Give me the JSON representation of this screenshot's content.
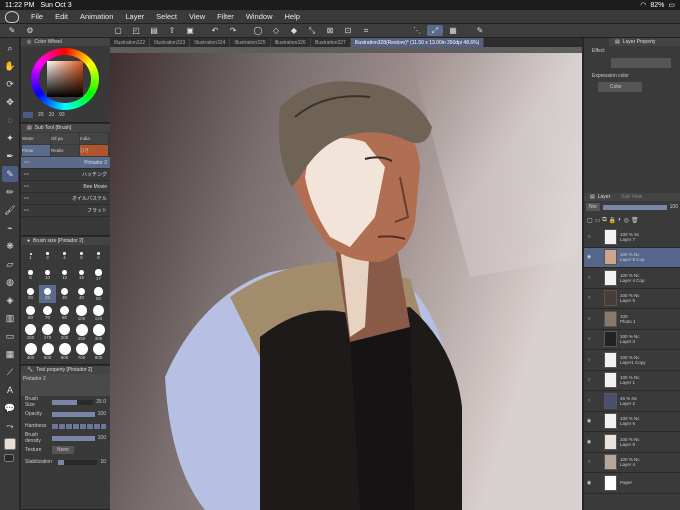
{
  "status": {
    "time": "11:22 PM",
    "date": "Sun Oct 3",
    "battery": "82%"
  },
  "menu": [
    "File",
    "Edit",
    "Animation",
    "Layer",
    "Select",
    "View",
    "Filter",
    "Window",
    "Help"
  ],
  "tabs": [
    "Illustration322",
    "Illustration323",
    "Illustration324",
    "Illustration325",
    "Illustration326",
    "Illustration327"
  ],
  "active_tab": "Illustration328(Restore)* (11.50 x 13.00in 350dpi 48.6%)",
  "color_wheel": {
    "title": "Color Wheel",
    "values": [
      "20",
      "10",
      "93"
    ]
  },
  "sub_tool": {
    "title": "Sub Tool [Brush]",
    "tabs": [
      "Water",
      "Oil pa",
      "India",
      "Pintar",
      "Realis",
      "ひき"
    ],
    "items": [
      "Pintador 2",
      "ハッチング",
      "Bee Movie",
      "オイルパステル",
      "フラット"
    ]
  },
  "brush_size": {
    "title": "Brush size [Pintador 2]",
    "sizes": [
      "1",
      "3",
      "4",
      "5",
      "6",
      "8",
      "10",
      "12",
      "15",
      "17",
      "20",
      "25",
      "30",
      "40",
      "50",
      "60",
      "70",
      "80",
      "100",
      "120",
      "150",
      "170",
      "200",
      "250",
      "300",
      "400",
      "500",
      "600",
      "700",
      "800"
    ]
  },
  "tool_property": {
    "title": "Tool property [Pintador 2]",
    "brush_name": "Pintador 2",
    "brush_size_label": "Brush Size",
    "brush_size_value": "25.0",
    "opacity_label": "Opacity",
    "opacity_value": "100",
    "hardness_label": "Hardness",
    "density_label": "Brush density",
    "density_value": "100",
    "texture_label": "Texture",
    "texture_value": "None",
    "stabilization_label": "Stabilization",
    "stabilization_value": "10"
  },
  "layer_property": {
    "title": "Layer Property",
    "effect_label": "Effect",
    "expression_label": "Expression color",
    "expression_value": "Color"
  },
  "layer_panel": {
    "title": "Layer",
    "subtitle": "Sub View",
    "blend": "Nor",
    "opacity": "100",
    "layers": [
      {
        "pct": "100 %",
        "mode": "Sc",
        "name": "Layer 7",
        "thumb": "#f2f2f2",
        "visible": false,
        "selected": false
      },
      {
        "pct": "100 %",
        "mode": "Nc",
        "name": "Layer 8 Cop",
        "thumb": "#caa68d",
        "visible": true,
        "selected": true
      },
      {
        "pct": "100 %",
        "mode": "Nc",
        "name": "Layer 4 Cop",
        "thumb": "#f2f2f2",
        "visible": false,
        "selected": false
      },
      {
        "pct": "100 %",
        "mode": "Nc",
        "name": "Layer 5",
        "thumb": "#4a3b35",
        "visible": false,
        "selected": false
      },
      {
        "pct": "100",
        "mode": "",
        "name": "Photo 1",
        "thumb": "#8a7968",
        "visible": false,
        "selected": false
      },
      {
        "pct": "100 %",
        "mode": "Nc",
        "name": "Layer 3",
        "thumb": "#222222",
        "visible": false,
        "selected": false
      },
      {
        "pct": "100 %",
        "mode": "Nc",
        "name": "Layer1 Copy",
        "thumb": "#f2f2f2",
        "visible": false,
        "selected": false
      },
      {
        "pct": "100 %",
        "mode": "Nc",
        "name": "Layer 1",
        "thumb": "#f2f2f2",
        "visible": false,
        "selected": false
      },
      {
        "pct": "46 %",
        "mode": "Nc",
        "name": "Layer 2",
        "thumb": "#4a4f6e",
        "visible": false,
        "selected": false
      },
      {
        "pct": "100 %",
        "mode": "Nc",
        "name": "Layer 6",
        "thumb": "#f2f2f2",
        "visible": true,
        "selected": false
      },
      {
        "pct": "100 %",
        "mode": "Nc",
        "name": "Layer 8",
        "thumb": "#ebe3da",
        "visible": true,
        "selected": false
      },
      {
        "pct": "100 %",
        "mode": "Nc",
        "name": "Layer 4",
        "thumb": "#b6a79a",
        "visible": false,
        "selected": false
      },
      {
        "pct": "",
        "mode": "",
        "name": "Paper",
        "thumb": "#ffffff",
        "visible": true,
        "selected": false
      }
    ]
  },
  "colors": {
    "accent": "#5a6b8c",
    "selected_layer": "#56658a",
    "canvas_bg": "#5d5d5d",
    "main_color": "#e7ddd3"
  }
}
